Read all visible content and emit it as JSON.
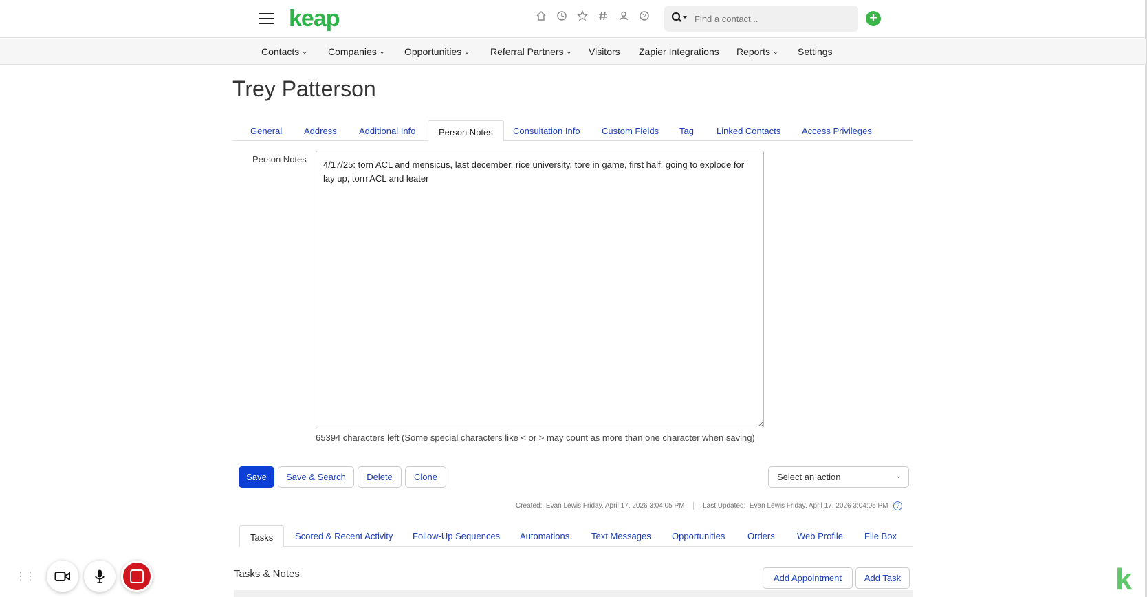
{
  "header": {
    "logo": "keap",
    "icons": [
      "home-icon",
      "clock-icon",
      "star-icon",
      "hash-icon",
      "user-icon",
      "help-icon"
    ],
    "search_placeholder": "Find a contact..."
  },
  "nav": {
    "items": [
      {
        "label": "Contacts",
        "dropdown": true
      },
      {
        "label": "Companies",
        "dropdown": true
      },
      {
        "label": "Opportunities",
        "dropdown": true
      },
      {
        "label": "Referral Partners",
        "dropdown": true
      },
      {
        "label": "Visitors",
        "dropdown": false
      },
      {
        "label": "Zapier Integrations",
        "dropdown": false
      },
      {
        "label": "Reports",
        "dropdown": true
      },
      {
        "label": "Settings",
        "dropdown": false
      }
    ]
  },
  "contact": {
    "name": "Trey Patterson"
  },
  "tabs": [
    "General",
    "Address",
    "Additional Info",
    "Person Notes",
    "Consultation Info",
    "Custom Fields",
    "Tag",
    "Linked Contacts",
    "Access Privileges"
  ],
  "active_tab": "Person Notes",
  "notes": {
    "label": "Person Notes",
    "value": "4/17/25: torn ACL and mensicus, last december, rice university, tore in game, first half, going to explode for lay up, torn ACL and leater",
    "chars_left": "65394 characters left (Some special characters like < or > may count as more than one character when saving)"
  },
  "actions": {
    "save": "Save",
    "save_search": "Save & Search",
    "delete": "Delete",
    "clone": "Clone",
    "select_action": "Select an action"
  },
  "meta": {
    "created_label": "Created:",
    "created_value": "Evan Lewis Friday, April 17, 2026 3:04:05 PM",
    "updated_label": "Last Updated:",
    "updated_value": "Evan Lewis Friday, April 17, 2026 3:04:05 PM"
  },
  "bottom_tabs": [
    "Tasks",
    "Scored & Recent Activity",
    "Follow-Up Sequences",
    "Automations",
    "Text Messages",
    "Opportunities",
    "Orders",
    "Web Profile",
    "File Box"
  ],
  "tasks": {
    "title": "Tasks & Notes",
    "add_appointment": "Add Appointment",
    "add_task": "Add Task"
  },
  "recorder": {
    "icons": [
      "camera-icon",
      "microphone-icon",
      "stop-icon"
    ]
  },
  "colors": {
    "brand": "#2fb44a",
    "link": "#1a3fb8",
    "primary_button": "#0d3fd6",
    "record": "#d0161f"
  }
}
